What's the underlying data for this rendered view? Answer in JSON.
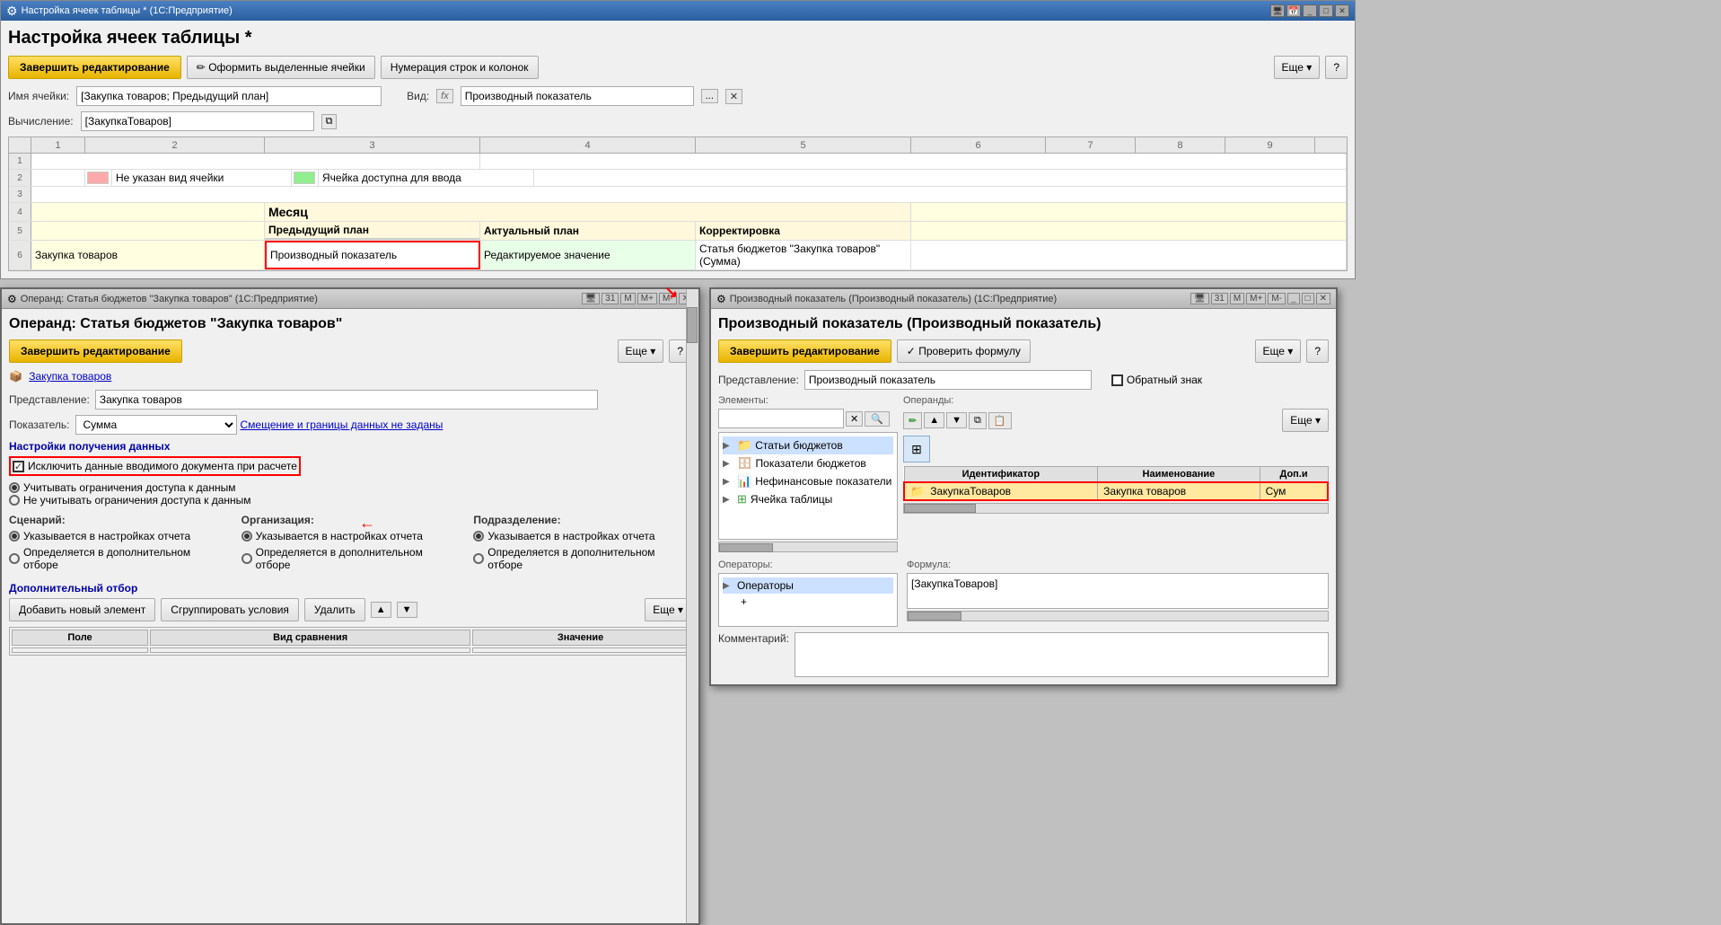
{
  "mainWindow": {
    "titleBar": {
      "title": "Настройка ячеек таблицы * (1С:Предприятие)",
      "icon": "⚙"
    },
    "pageTitle": "Настройка ячеек таблицы *",
    "toolbar": {
      "finishBtn": "Завершить редактирование",
      "formatBtn": "Оформить выделенные ячейки",
      "numberingBtn": "Нумерация строк и колонок",
      "moreBtn": "Еще",
      "helpBtn": "?"
    },
    "cellNameLabel": "Имя ячейки:",
    "cellNameValue": "[Закупка товаров; Предыдущий план]",
    "viewLabel": "Вид:",
    "fxLabel": "fx",
    "viewValue": "Производный показатель",
    "calcLabel": "Вычисление:",
    "calcValue": "[ЗакупкаТоваров]",
    "grid": {
      "rulers": [
        "1",
        "2",
        "3",
        "4",
        "5",
        "6",
        "7",
        "8",
        "9"
      ],
      "row2": {
        "pinkLabel": "",
        "notSpecified": "Не указан вид ячейки",
        "greenLabel": "",
        "available": "Ячейка доступна для ввода"
      },
      "row4header": "Месяц",
      "row5cols": {
        "prev": "Предыдущий план",
        "actual": "Актуальный план",
        "correction": "Корректировка"
      },
      "row6": {
        "rowLabel": "Закупка товаров",
        "prevValue": "Производный показатель",
        "actualValue": "Редактируемое значение",
        "corrValue": "Статья бюджетов \"Закупка товаров\" (Сумма)"
      }
    }
  },
  "leftSubWindow": {
    "titleBar": {
      "title": "Операнд: Статья бюджетов \"Закупка товаров\" (1С:Предприятие)",
      "icon": "⚙"
    },
    "pageTitle": "Операнд: Статья бюджетов \"Закупка товаров\"",
    "toolbar": {
      "finishBtn": "Завершить редактирование",
      "moreBtn": "Еще",
      "helpBtn": "?"
    },
    "linkText": "Закупка товаров",
    "representationLabel": "Представление:",
    "representationValue": "Закупка товаров",
    "indicatorLabel": "Показатель:",
    "indicatorValue": "Сумма",
    "offsetLink": "Смещение и границы данных не заданы",
    "sectionTitle": "Настройки получения данных",
    "checkboxLabel": "Исключить данные вводимого документа при расчете",
    "accessRadio1": "Учитывать ограничения доступа к данным",
    "accessRadio2": "Не  учитывать ограничения доступа к данным",
    "scenarioLabel": "Сценарий:",
    "orgLabel": "Организация:",
    "subdivisionLabel": "Подразделение:",
    "scenarioRadio1": "Указывается в настройках отчета",
    "scenarioRadio2": "Определяется в дополнительном отборе",
    "orgRadio1": "Указывается в настройках отчета",
    "orgRadio2": "Определяется в дополнительном отборе",
    "subdivRadio1": "Указывается в настройках отчета",
    "subdivRadio2": "Определяется в дополнительном отборе",
    "extraFilterTitle": "Дополнительный отбор",
    "addElementBtn": "Добавить новый элемент",
    "groupBtn": "Сгруппировать условия",
    "deleteBtn": "Удалить",
    "moreBtn": "Еще",
    "tableHeaders": [
      "Поле",
      "Вид сравнения",
      "Значение"
    ]
  },
  "rightSubWindow": {
    "titleBar": {
      "title": "Производный показатель (Производный показатель) (1С:Предприятие)",
      "icon": "⚙"
    },
    "pageTitle": "Производный показатель (Производный показатель)",
    "toolbar": {
      "finishBtn": "Завершить редактирование",
      "checkFormulaBtn": "Проверить формулу",
      "moreBtn": "Еще",
      "helpBtn": "?"
    },
    "representationLabel": "Представление:",
    "representationValue": "Производный показатель",
    "invertLabel": "Обратный знак",
    "elementsLabel": "Элементы:",
    "operandsLabel": "Операнды:",
    "searchPlaceholder": "",
    "treeItems": [
      {
        "id": "budget-articles",
        "label": "Статьи бюджетов",
        "icon": "folder",
        "expanded": true
      },
      {
        "id": "budget-indicators",
        "label": "Показатели бюджетов",
        "icon": "db",
        "expanded": false
      },
      {
        "id": "nonfinancial",
        "label": "Нефинансовые показатели",
        "icon": "chart",
        "expanded": false
      },
      {
        "id": "table-cell",
        "label": "Ячейка таблицы",
        "icon": "grid",
        "expanded": false
      }
    ],
    "operandsTableHeaders": [
      "Идентификатор",
      "Наименование",
      "Доп.и"
    ],
    "operandsRows": [
      {
        "identifier": "ЗакупкаТоваров",
        "name": "Закупка товаров",
        "extra": "Сум"
      }
    ],
    "operatorsLabel": "Операторы:",
    "operatorsItems": [
      {
        "label": "Операторы",
        "expanded": true
      },
      {
        "label": "+"
      }
    ],
    "formulaLabel": "Формула:",
    "formulaValue": "[ЗакупкаТоваров]",
    "commentLabel": "Комментарий:"
  }
}
